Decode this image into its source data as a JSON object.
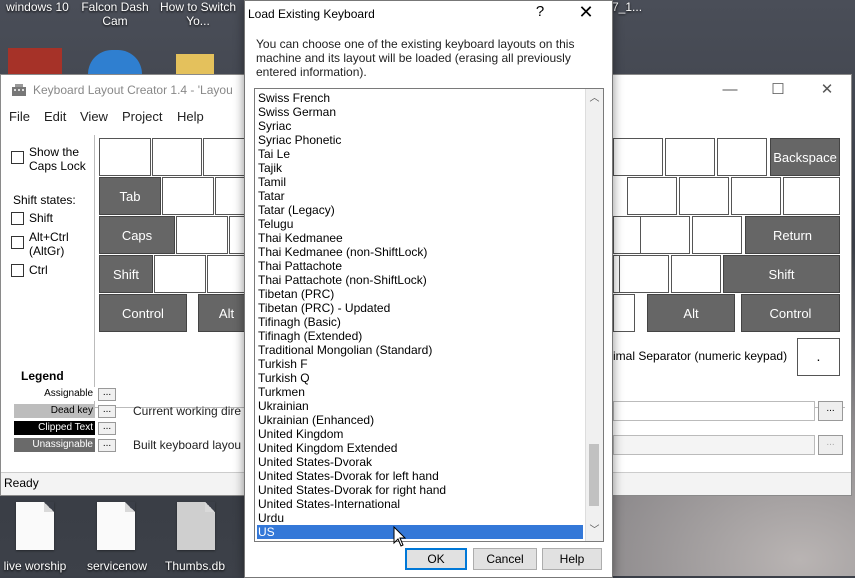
{
  "desktop": {
    "top_labels": [
      "windows 10",
      "Falcon Dash Cam",
      "How to Switch Yo...",
      "7_1..."
    ],
    "bottom_labels": [
      "live worship",
      "servicenow",
      "Thumbs.db"
    ]
  },
  "kbd_window": {
    "title": "Keyboard Layout Creator 1.4 - 'Layou",
    "controls": {
      "minimize": "—",
      "maximize": "☐",
      "close": "✕"
    },
    "menu": [
      "File",
      "Edit",
      "View",
      "Project",
      "Help"
    ],
    "show_caps_lock": "Show the Caps Lock",
    "shift_states_label": "Shift states:",
    "shift_states": [
      "Shift",
      "Alt+Ctrl (AltGr)",
      "Ctrl"
    ],
    "keys": {
      "tab": "Tab",
      "caps": "Caps",
      "shift_left": "Shift",
      "control_left": "Control",
      "alt_left": "Alt",
      "backspace": "Backspace",
      "return": "Return",
      "shift_right": "Shift",
      "alt_right": "Alt",
      "control_right": "Control",
      "decimal_key": "."
    },
    "decimal_separator_label": "imal Separator (numeric keypad)",
    "legend": {
      "title": "Legend",
      "items": [
        "Assignable",
        "Dead key",
        "Clipped Text",
        "Unassignable"
      ],
      "dots": "..."
    },
    "current_dir_label": "Current working dire",
    "built_layout_label": "Built keyboard layou",
    "browse_button": "...",
    "status": "Ready"
  },
  "dialog": {
    "title": "Load Existing Keyboard",
    "help": "?",
    "close": "✕",
    "description": "You can choose one of the existing  keyboard layouts on this machine and its layout will be loaded (erasing all previously entered information).",
    "items": [
      "Swiss French",
      "Swiss German",
      "Syriac",
      "Syriac Phonetic",
      "Tai Le",
      "Tajik",
      "Tamil",
      "Tatar",
      "Tatar (Legacy)",
      "Telugu",
      "Thai Kedmanee",
      "Thai Kedmanee (non-ShiftLock)",
      "Thai Pattachote",
      "Thai Pattachote (non-ShiftLock)",
      "Tibetan (PRC)",
      "Tibetan (PRC) - Updated",
      "Tifinagh (Basic)",
      "Tifinagh (Extended)",
      "Traditional Mongolian (Standard)",
      "Turkish F",
      "Turkish Q",
      "Turkmen",
      "Ukrainian",
      "Ukrainian (Enhanced)",
      "United Kingdom",
      "United Kingdom Extended",
      "United States-Dvorak",
      "United States-Dvorak for left hand",
      "United States-Dvorak for right hand",
      "United States-International",
      "Urdu",
      "US"
    ],
    "selected": "US",
    "scroll_up": "︿",
    "scroll_down": "﹀",
    "buttons": {
      "ok": "OK",
      "cancel": "Cancel",
      "help": "Help"
    }
  },
  "colors": {
    "selection": "#3478d8",
    "key_dark": "#666666",
    "accent": "#0078d7"
  }
}
